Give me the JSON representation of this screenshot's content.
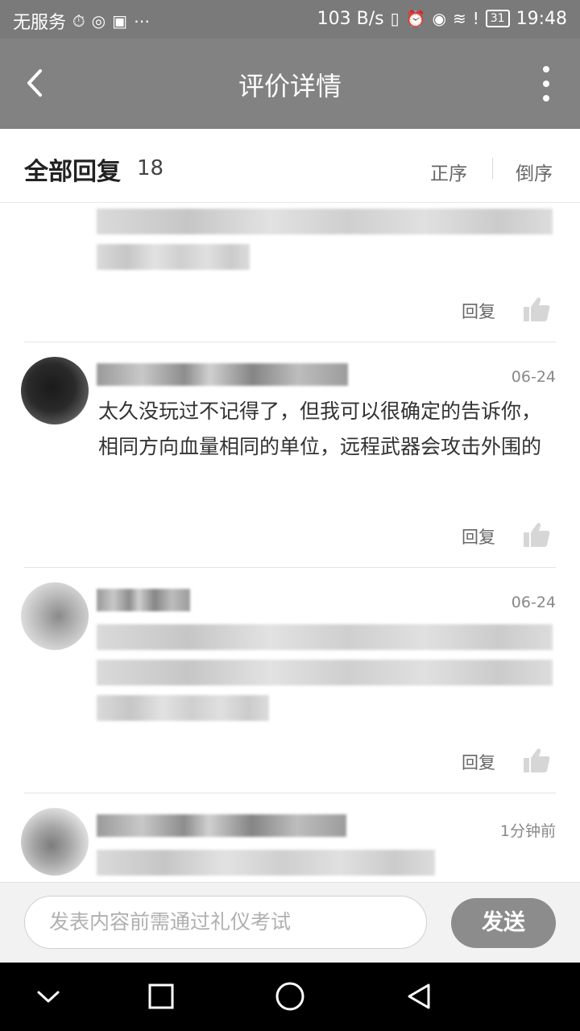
{
  "status_bar": {
    "carrier": "无服务",
    "network_speed": "103 B/s",
    "battery": "31",
    "time": "19:48"
  },
  "header": {
    "title": "评价详情",
    "back_icon": "chevron-left-icon",
    "more_icon": "more-vertical-icon"
  },
  "replies": {
    "title": "全部回复",
    "count": "18",
    "sort_ascending": "正序",
    "sort_descending": "倒序"
  },
  "comments": [
    {
      "time": "",
      "text": "",
      "reply_label": "回复",
      "like_icon": "thumbs-up-icon"
    },
    {
      "time": "06-24",
      "text": "太久没玩过不记得了，但我可以很确定的告诉你，相同方向血量相同的单位，远程武器会攻击外围的",
      "reply_label": "回复",
      "like_icon": "thumbs-up-icon"
    },
    {
      "time": "06-24",
      "text": "",
      "reply_label": "回复",
      "like_icon": "thumbs-up-icon"
    },
    {
      "time": "1分钟前",
      "text": ""
    }
  ],
  "input": {
    "placeholder": "发表内容前需通过礼仪考试",
    "send_label": "发送"
  },
  "colors": {
    "header_bg": "#828282",
    "status_bg": "#7a7a7a",
    "send_bg": "#8c8c8c"
  }
}
